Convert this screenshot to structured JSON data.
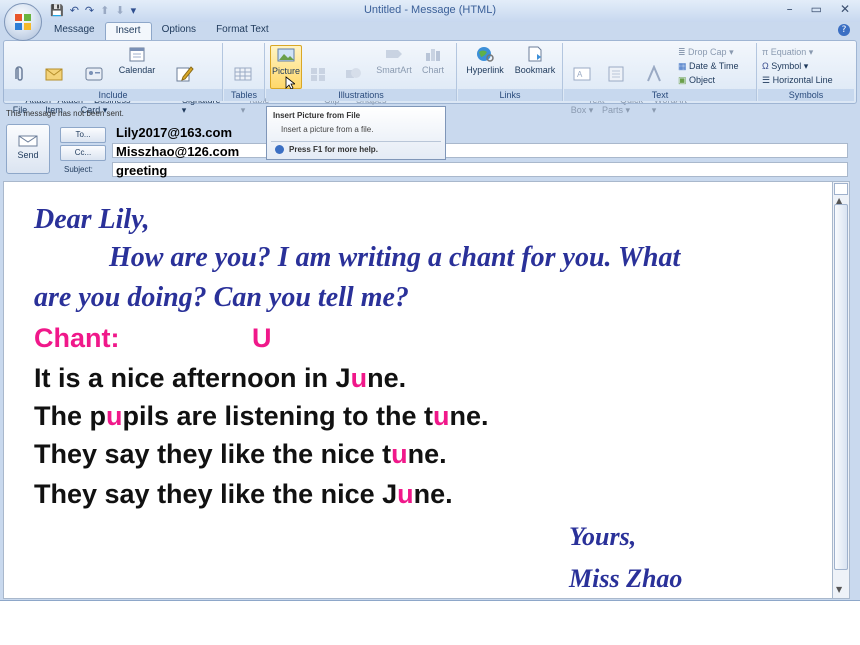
{
  "window": {
    "title": "Untitled - Message (HTML)",
    "controls": {
      "minimize": "–",
      "maximize": "▭",
      "close": "✕"
    },
    "qat": {
      "save": "💾",
      "undo": "↶",
      "redo": "↷",
      "up": "⬆",
      "down": "⬇",
      "more": "▾"
    }
  },
  "tabs": [
    "Message",
    "Insert",
    "Options",
    "Format Text"
  ],
  "active_tab": "Insert",
  "ribbon": {
    "include": {
      "label": "Include",
      "attach_file": "Attach\nFile",
      "attach_item": "Attach\nItem",
      "business_card": "Business\nCard ▾",
      "calendar": "Calendar",
      "signature": "Signature\n▾"
    },
    "tables": {
      "label": "Tables",
      "table": "Table\n▾"
    },
    "illustrations": {
      "label": "Illustrations",
      "picture": "Picture",
      "clip_art": "Clip\nArt",
      "shapes": "Shapes\n▾",
      "smartart": "SmartArt",
      "chart": "Chart"
    },
    "links": {
      "label": "Links",
      "hyperlink": "Hyperlink",
      "bookmark": "Bookmark"
    },
    "text": {
      "label": "Text",
      "text_box": "Text\nBox ▾",
      "quick_parts": "Quick\nParts ▾",
      "wordart": "WordArt\n▾",
      "drop_cap": "Drop Cap ▾",
      "date_time": "Date & Time",
      "object": "Object"
    },
    "symbols": {
      "label": "Symbols",
      "equation": "Equation ▾",
      "symbol": "Symbol ▾",
      "horizontal_line": "Horizontal Line"
    }
  },
  "tooltip": {
    "title": "Insert Picture from File",
    "description": "Insert a picture from a file.",
    "help": "Press F1 for more help."
  },
  "header": {
    "info": "This message has not been sent.",
    "send": "Send",
    "to_button": "To...",
    "cc_button": "Cc...",
    "subject_label": "Subject:",
    "to_value": "Lily2017@163.com",
    "cc_value": "Misszhao@126.com",
    "subject_value": "greeting"
  },
  "letter": {
    "greeting": "Dear Lily,",
    "line1": "How are you? I am writing a chant for you. What",
    "line2": "are you doing? Can you tell me?",
    "chant_label": "Chant:",
    "chant_letter": "U",
    "chant_lines": [
      [
        "It is a nice afternoon in J",
        "u",
        "ne."
      ],
      [
        "The p",
        "u",
        "pils are listening to the t",
        "u",
        "ne."
      ],
      [
        "They say they like the nice t",
        "u",
        "ne."
      ],
      [
        "They say they like the nice J",
        "u",
        "ne."
      ]
    ],
    "closing": "Yours,",
    "signature": "Miss Zhao"
  },
  "colors": {
    "letter_blue": "#2a3199",
    "highlight_pink": "#f0188a",
    "ribbon_blue": "#c9d9ee"
  }
}
